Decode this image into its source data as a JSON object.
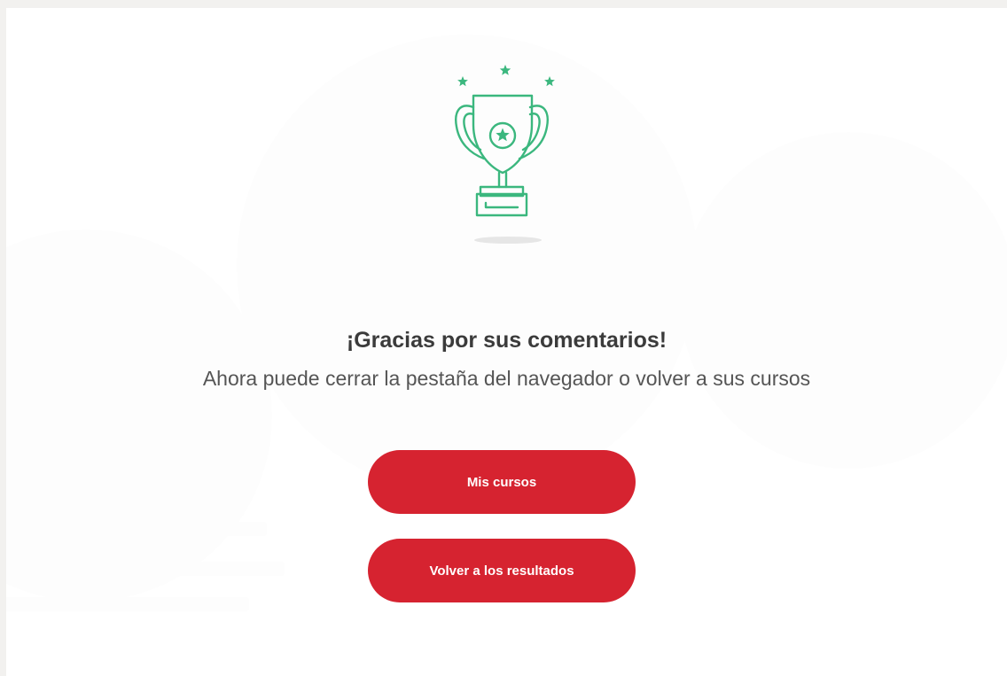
{
  "feedback": {
    "title": "¡Gracias por sus comentarios!",
    "message": "Ahora puede cerrar la pestaña del navegador o volver a sus cursos",
    "icon": "trophy-icon"
  },
  "actions": {
    "my_courses_label": "Mis cursos",
    "back_to_results_label": "Volver a los resultados"
  },
  "colors": {
    "accent": "#d62330",
    "icon_green": "#3bb77e",
    "title_text": "#3b3b3b",
    "body_text": "#555555"
  }
}
